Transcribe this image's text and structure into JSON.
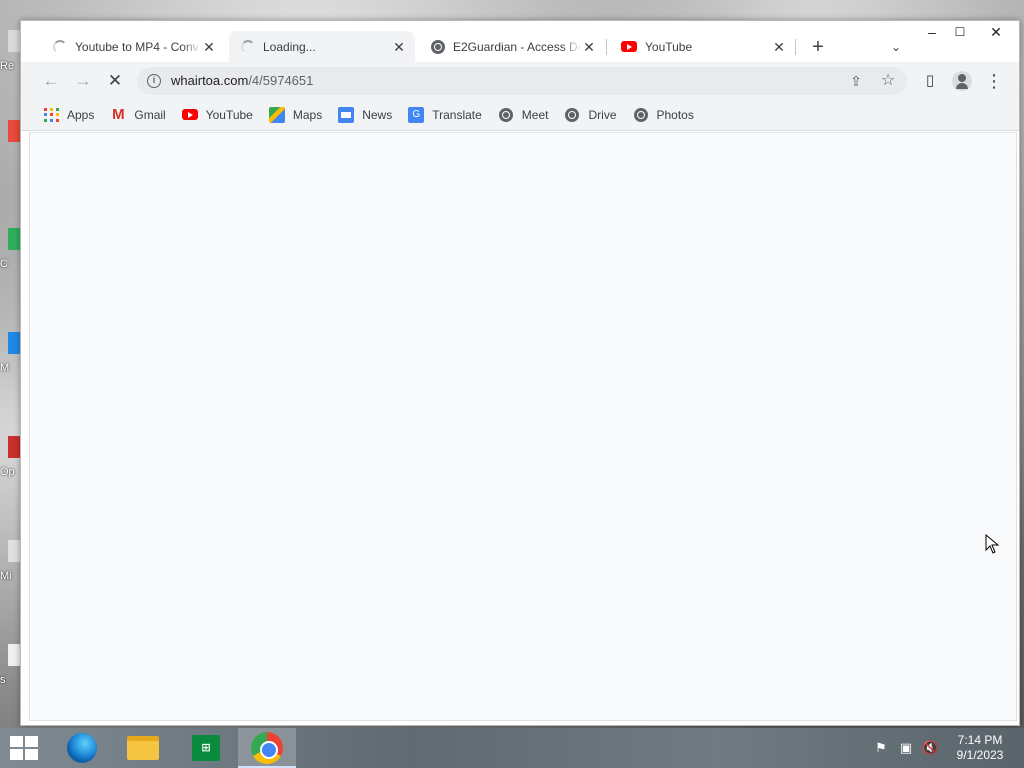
{
  "desktop": {
    "icon_labels": [
      "Re",
      "C",
      "M",
      "Op",
      "Mi",
      "s"
    ]
  },
  "browser": {
    "tabs": [
      {
        "title": "Youtube to MP4 - Conv",
        "icon": "loading-spinner-icon",
        "active": false
      },
      {
        "title": "Loading...",
        "icon": "loading-spinner-icon",
        "active": true
      },
      {
        "title": "E2Guardian - Access De",
        "icon": "globe-icon",
        "active": false
      },
      {
        "title": "YouTube",
        "icon": "youtube-icon",
        "active": false
      }
    ],
    "new_tab_label": "+",
    "tab_search_label": "⌄",
    "window_controls": {
      "minimize": "–",
      "maximize": "☐",
      "close": "✕"
    },
    "close_tab_label": "✕",
    "toolbar": {
      "back": "←",
      "forward": "→",
      "stop": "✕",
      "url_host": "whairtoa.com",
      "url_path": "/4/5974651",
      "share": "⇪",
      "bookmark_star": "☆",
      "side_panel": "▯",
      "menu": "⋮"
    },
    "bookmarks": [
      {
        "label": "Apps",
        "icon": "apps-grid-icon"
      },
      {
        "label": "Gmail",
        "icon": "gmail-icon"
      },
      {
        "label": "YouTube",
        "icon": "youtube-icon"
      },
      {
        "label": "Maps",
        "icon": "maps-icon"
      },
      {
        "label": "News",
        "icon": "news-icon"
      },
      {
        "label": "Translate",
        "icon": "translate-icon"
      },
      {
        "label": "Meet",
        "icon": "globe-icon"
      },
      {
        "label": "Drive",
        "icon": "globe-icon"
      },
      {
        "label": "Photos",
        "icon": "globe-icon"
      }
    ]
  },
  "taskbar": {
    "apps": [
      "start-button",
      "edge-icon",
      "file-explorer-icon",
      "store-icon",
      "chrome-icon"
    ],
    "store_glyph": "⊞",
    "tray": {
      "flag": "⚑",
      "network": "▣",
      "volume": "🔇"
    },
    "clock_time": "7:14 PM",
    "clock_date": "9/1/2023"
  },
  "colors": {
    "toolbar_bg": "#f1f3f4",
    "content_bg": "#f8fafc",
    "youtube_red": "#ff0000"
  }
}
